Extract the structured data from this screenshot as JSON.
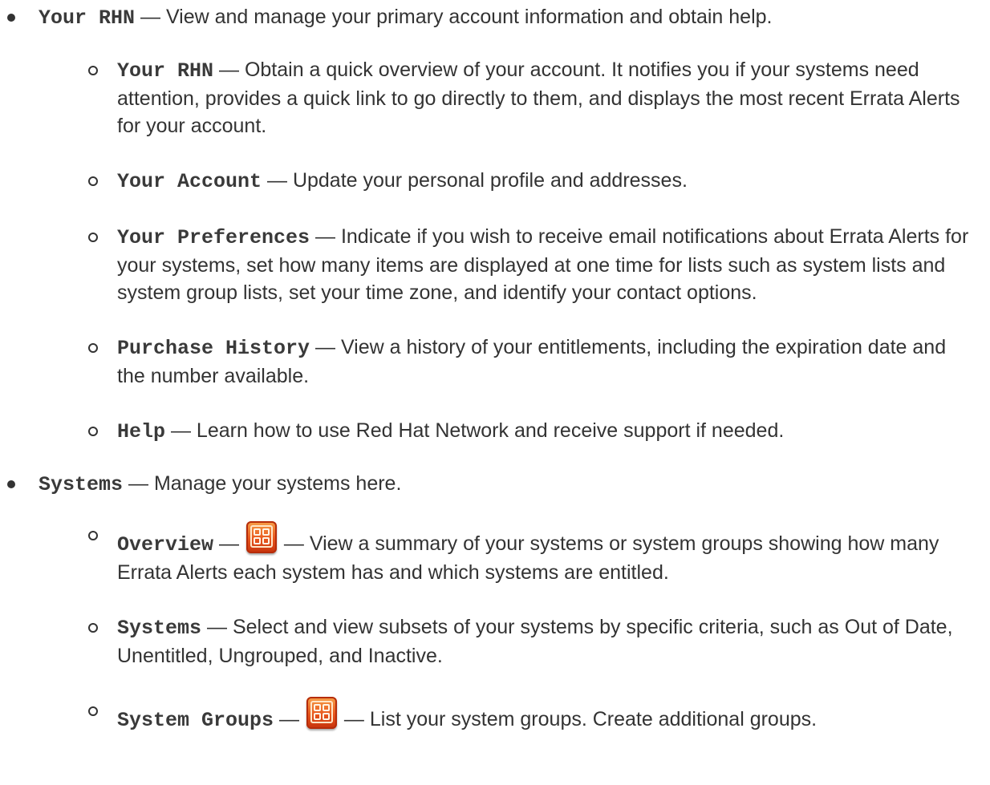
{
  "sections": [
    {
      "term": "Your RHN",
      "separator": "—",
      "description": "View and manage your primary account information and obtain help.",
      "items": [
        {
          "term": "Your RHN",
          "separator": "—",
          "description": "Obtain a quick overview of your account. It notifies you if your systems need attention, provides a quick link to go directly to them, and displays the most recent Errata Alerts for your account."
        },
        {
          "term": "Your Account",
          "separator": "—",
          "description": "Update your personal profile and addresses."
        },
        {
          "term": "Your Preferences",
          "separator": "—",
          "description": "Indicate if you wish to receive email notifications about Errata Alerts for your systems, set how many items are displayed at one time for lists such as system lists and system group lists, set your time zone, and identify your contact options."
        },
        {
          "term": "Purchase History",
          "separator": "—",
          "description": "View a history of your entitlements, including the expiration date and the number available."
        },
        {
          "term": "Help",
          "separator": "—",
          "description": "Learn how to use Red Hat Network and receive support if needed."
        }
      ]
    },
    {
      "term": "Systems",
      "separator": "—",
      "description": "Manage your systems here.",
      "items": [
        {
          "term": "Overview",
          "separator": "—",
          "icon": "rhn-management-entitlement-icon",
          "separator2": "—",
          "description": "View a summary of your systems or system groups showing how many Errata Alerts each system has and which systems are entitled."
        },
        {
          "term": "Systems",
          "separator": "—",
          "description": "Select and view subsets of your systems by specific criteria, such as Out of Date, Unentitled, Ungrouped, and Inactive."
        },
        {
          "term": "System Groups",
          "separator": "—",
          "icon": "rhn-management-entitlement-icon",
          "separator2": "—",
          "description": "List your system groups. Create additional groups."
        }
      ]
    }
  ]
}
